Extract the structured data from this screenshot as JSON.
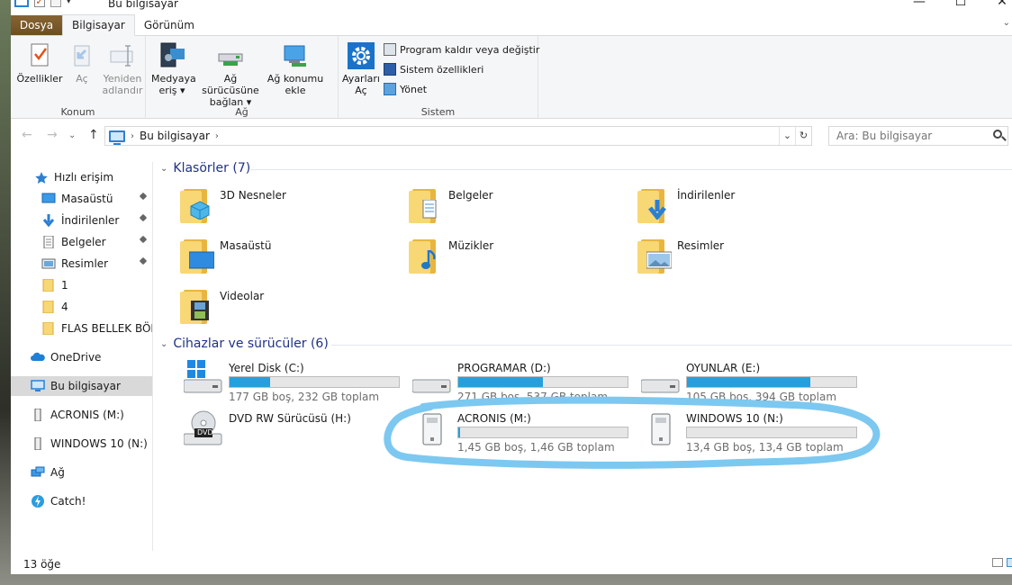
{
  "window": {
    "title": "Bu bilgisayar",
    "controls": {
      "minimize": "—",
      "maximize": "☐",
      "close": "✕"
    }
  },
  "ribbon": {
    "tabs": [
      {
        "label": "Dosya"
      },
      {
        "label": "Bilgisayar"
      },
      {
        "label": "Görünüm"
      }
    ],
    "groups": {
      "konum": {
        "label": "Konum",
        "properties": "Özellikler",
        "open": "Aç",
        "rename_line1": "Yeniden",
        "rename_line2": "adlandır"
      },
      "ag": {
        "label": "Ağ",
        "media_line1": "Medyaya",
        "media_line2": "eriş ▾",
        "map_line1": "Ağ sürücüsüne",
        "map_line2": "bağlan ▾",
        "netloc_line1": "Ağ konumu",
        "netloc_line2": "ekle"
      },
      "sistem": {
        "label": "Sistem",
        "settings_line1": "Ayarları",
        "settings_line2": "Aç",
        "uninstall": "Program kaldır veya değiştir",
        "sysprops": "Sistem özellikleri",
        "manage": "Yönet"
      }
    }
  },
  "address": {
    "path": "Bu bilgisayar",
    "search_placeholder": "Ara: Bu bilgisayar"
  },
  "nav": {
    "items": [
      {
        "label": "Hızlı erişim"
      },
      {
        "label": "Masaüstü"
      },
      {
        "label": "İndirilenler"
      },
      {
        "label": "Belgeler"
      },
      {
        "label": "Resimler"
      },
      {
        "label": "1"
      },
      {
        "label": "4"
      },
      {
        "label": "FLAS BELLEK BÖLM"
      },
      {
        "label": "OneDrive"
      },
      {
        "label": "Bu bilgisayar"
      },
      {
        "label": "ACRONIS (M:)"
      },
      {
        "label": "WINDOWS 10 (N:)"
      },
      {
        "label": "Ağ"
      },
      {
        "label": "Catch!"
      }
    ]
  },
  "content": {
    "folders_header": "Klasörler (7)",
    "folders": [
      {
        "label": "3D Nesneler"
      },
      {
        "label": "Belgeler"
      },
      {
        "label": "İndirilenler"
      },
      {
        "label": "Masaüstü"
      },
      {
        "label": "Müzikler"
      },
      {
        "label": "Resimler"
      },
      {
        "label": "Videolar"
      }
    ],
    "devices_header": "Cihazlar ve sürücüler (6)",
    "drives": [
      {
        "label": "Yerel Disk (C:)",
        "sub": "177 GB boş, 232 GB toplam",
        "used_fraction": 0.24
      },
      {
        "label": "PROGRAMAR (D:)",
        "sub": "271 GB boş, 537 GB toplam",
        "used_fraction": 0.5
      },
      {
        "label": "OYUNLAR (E:)",
        "sub": "105 GB boş, 394 GB toplam",
        "used_fraction": 0.73
      },
      {
        "label": "DVD RW Sürücüsü (H:)",
        "dvd_text": "DVD"
      },
      {
        "label": "ACRONIS (M:)",
        "sub": "1,45 GB boş, 1,46 GB toplam",
        "used_fraction": 0.01
      },
      {
        "label": "WINDOWS 10 (N:)",
        "sub": "13,4 GB boş, 13,4 GB toplam",
        "used_fraction": 0.0
      }
    ]
  },
  "status": {
    "count": "13 öğe"
  },
  "colors": {
    "accent": "#26a0da",
    "file_tab": "#7a5a2a",
    "annotation": "#7cc8f0",
    "header_text": "#1e3287"
  }
}
